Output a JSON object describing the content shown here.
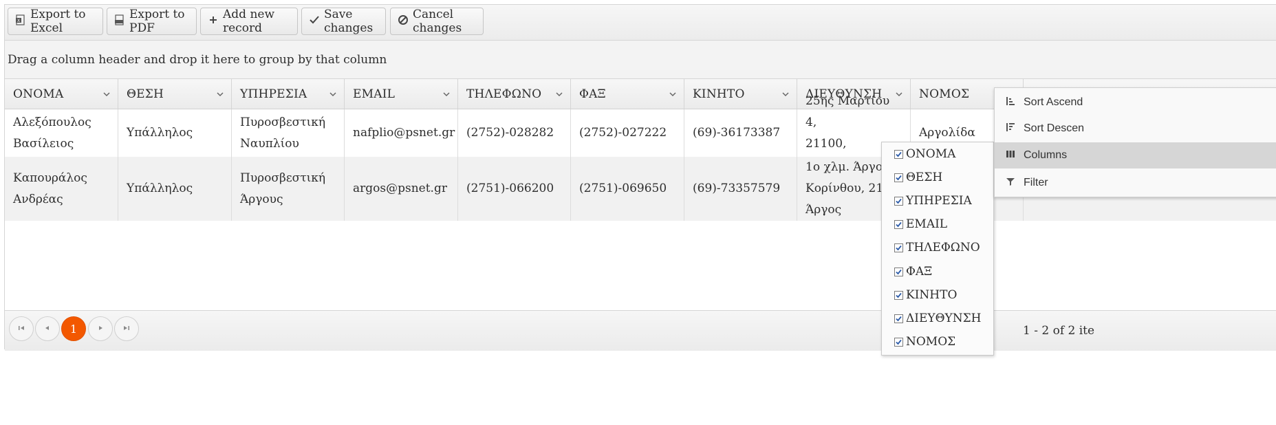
{
  "toolbar": {
    "export_excel": "Export to Excel",
    "export_pdf": "Export to PDF",
    "add_record": "Add new record",
    "save_changes": "Save changes",
    "cancel_changes": "Cancel changes"
  },
  "group_hint": "Drag a column header and drop it here to group by that column",
  "columns": [
    "ΟΝΟΜΑ",
    "ΘΕΣΗ",
    "ΥΠΗΡΕΣΙΑ",
    "EMAIL",
    "ΤΗΛΕΦΩΝΟ",
    "ΦΑΞ",
    "ΚΙΝΗΤΟ",
    "ΔΙΕΥΘΥΝΣΗ",
    "ΝΟΜΟΣ"
  ],
  "rows": [
    {
      "onoma": [
        "Αλεξόπουλος",
        "Βασίλειος"
      ],
      "thesi": "Υπάλληλος",
      "ypiresia": [
        "Πυροσβεστική",
        "Ναυπλίου"
      ],
      "email": "nafplio@psnet.gr",
      "tilefono": "(2752)-028282",
      "fax": "(2752)-027222",
      "kinito": "(69)-36173387",
      "dieuthinsi": [
        "25ης Μαρτίου 4,",
        "21100, Ναύπλιο"
      ],
      "nomos": "Αργολίδα"
    },
    {
      "onoma": [
        "Καπουράλος",
        "Ανδρέας"
      ],
      "thesi": "Υπάλληλος",
      "ypiresia": [
        "Πυροσβεστική",
        "Άργους"
      ],
      "email": "argos@psnet.gr",
      "tilefono": "(2751)-066200",
      "fax": "(2751)-069650",
      "kinito": "(69)-73357579",
      "dieuthinsi": [
        "1ο χλμ. Άργους",
        "Κορίνθου, 21200,",
        "Άργος"
      ],
      "nomos": ""
    }
  ],
  "pager": {
    "current_page": "1",
    "info": "1 - 2 of 2 ite"
  },
  "column_menu": {
    "items": [
      {
        "label": "ΟΝΟΜΑ",
        "checked": true
      },
      {
        "label": "ΘΕΣΗ",
        "checked": true
      },
      {
        "label": "ΥΠΗΡΕΣΙΑ",
        "checked": true
      },
      {
        "label": "EMAIL",
        "checked": true
      },
      {
        "label": "ΤΗΛΕΦΩΝΟ",
        "checked": true
      },
      {
        "label": "ΦΑΞ",
        "checked": true
      },
      {
        "label": "ΚΙΝΗΤΟ",
        "checked": true
      },
      {
        "label": "ΔΙΕΥΘΥΝΣΗ",
        "checked": true
      },
      {
        "label": "ΝΟΜΟΣ",
        "checked": true
      }
    ]
  },
  "header_menu": {
    "sort_asc": "Sort Ascend",
    "sort_desc": "Sort Descen",
    "columns": "Columns",
    "filter": "Filter"
  },
  "colors": {
    "accent": "#f35800",
    "menu_active": "#d6d6d6"
  }
}
